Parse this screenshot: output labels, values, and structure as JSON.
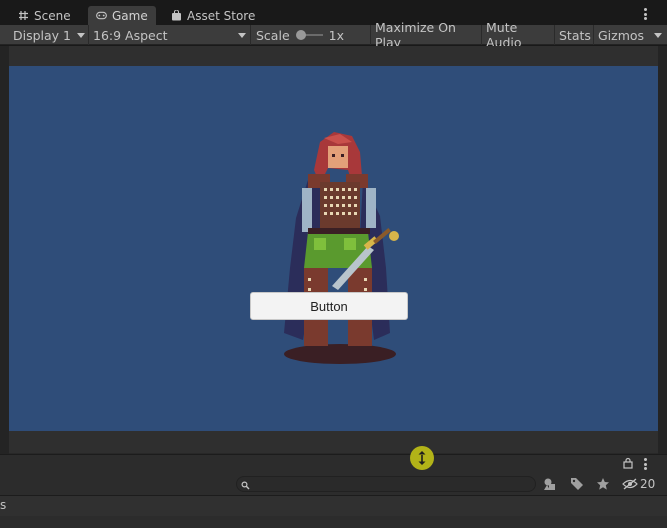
{
  "tabs": [
    {
      "label": "Scene",
      "icon": "grid-icon"
    },
    {
      "label": "Game",
      "icon": "gamepad-icon"
    },
    {
      "label": "Asset Store",
      "icon": "shopping-bag-icon"
    }
  ],
  "toolbar": {
    "display": "Display 1",
    "aspect": "16:9 Aspect",
    "scale_label": "Scale",
    "scale_value": "1x",
    "maximize": "Maximize On Play",
    "mute": "Mute Audio",
    "stats": "Stats",
    "gizmos": "Gizmos"
  },
  "game_view": {
    "background_color": "#2f4d79",
    "button_label": "Button"
  },
  "hierarchy": {
    "search_value": "",
    "hidden_count": "20",
    "row_text": "s"
  },
  "colors": {
    "accent_handle": "#b2b318"
  }
}
